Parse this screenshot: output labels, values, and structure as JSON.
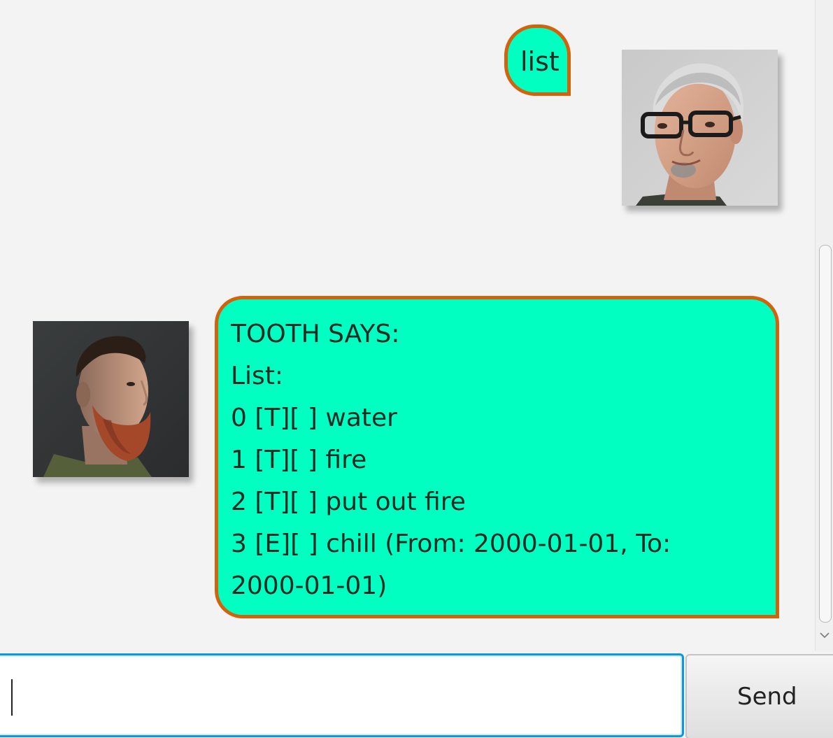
{
  "chat": {
    "messages": [
      {
        "sender": "user",
        "avatar_icon": "user-avatar-glasses-man",
        "lines": [
          "list"
        ]
      },
      {
        "sender": "bot",
        "avatar_icon": "bot-avatar-bearded-man",
        "lines": [
          "TOOTH SAYS:",
          "List:",
          "0 [T][ ] water",
          "1 [T][ ] fire",
          "2 [T][ ] put out fire",
          "3 [E][ ] chill (From: 2000-01-01, To:",
          "2000-01-01)"
        ]
      }
    ]
  },
  "input": {
    "value": "",
    "placeholder": ""
  },
  "send_button": {
    "label": "Send"
  },
  "colors": {
    "bubble_fill": "#00ffc0",
    "bubble_border": "#d2620c",
    "input_focus": "#0f96dc",
    "background": "#f3f3f3"
  }
}
